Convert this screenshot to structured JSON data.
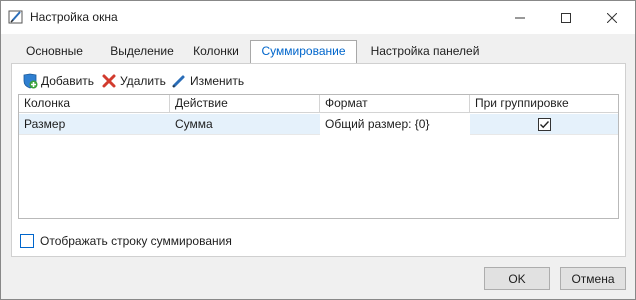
{
  "window": {
    "title": "Настройка окна"
  },
  "tabs": [
    {
      "label": "Основные"
    },
    {
      "label": "Выделение"
    },
    {
      "label": "Колонки"
    },
    {
      "label": "Суммирование"
    },
    {
      "label": "Настройка панелей"
    }
  ],
  "active_tab": "Суммирование",
  "toolbar": {
    "add_label": "Добавить",
    "delete_label": "Удалить",
    "edit_label": "Изменить"
  },
  "grid": {
    "columns": [
      "Колонка",
      "Действие",
      "Формат",
      "При группировке"
    ],
    "rows": [
      {
        "column": "Размер",
        "action": "Сумма",
        "format": "Общий размер: {0}",
        "on_grouping": true
      }
    ]
  },
  "show_summary_row": {
    "label": "Отображать строку суммирования",
    "checked": false
  },
  "buttons": {
    "ok": "OK",
    "cancel": "Отмена"
  },
  "colors": {
    "accent": "#0066cc",
    "selection": "#e5f1fb",
    "delete_red": "#d23b2e"
  }
}
